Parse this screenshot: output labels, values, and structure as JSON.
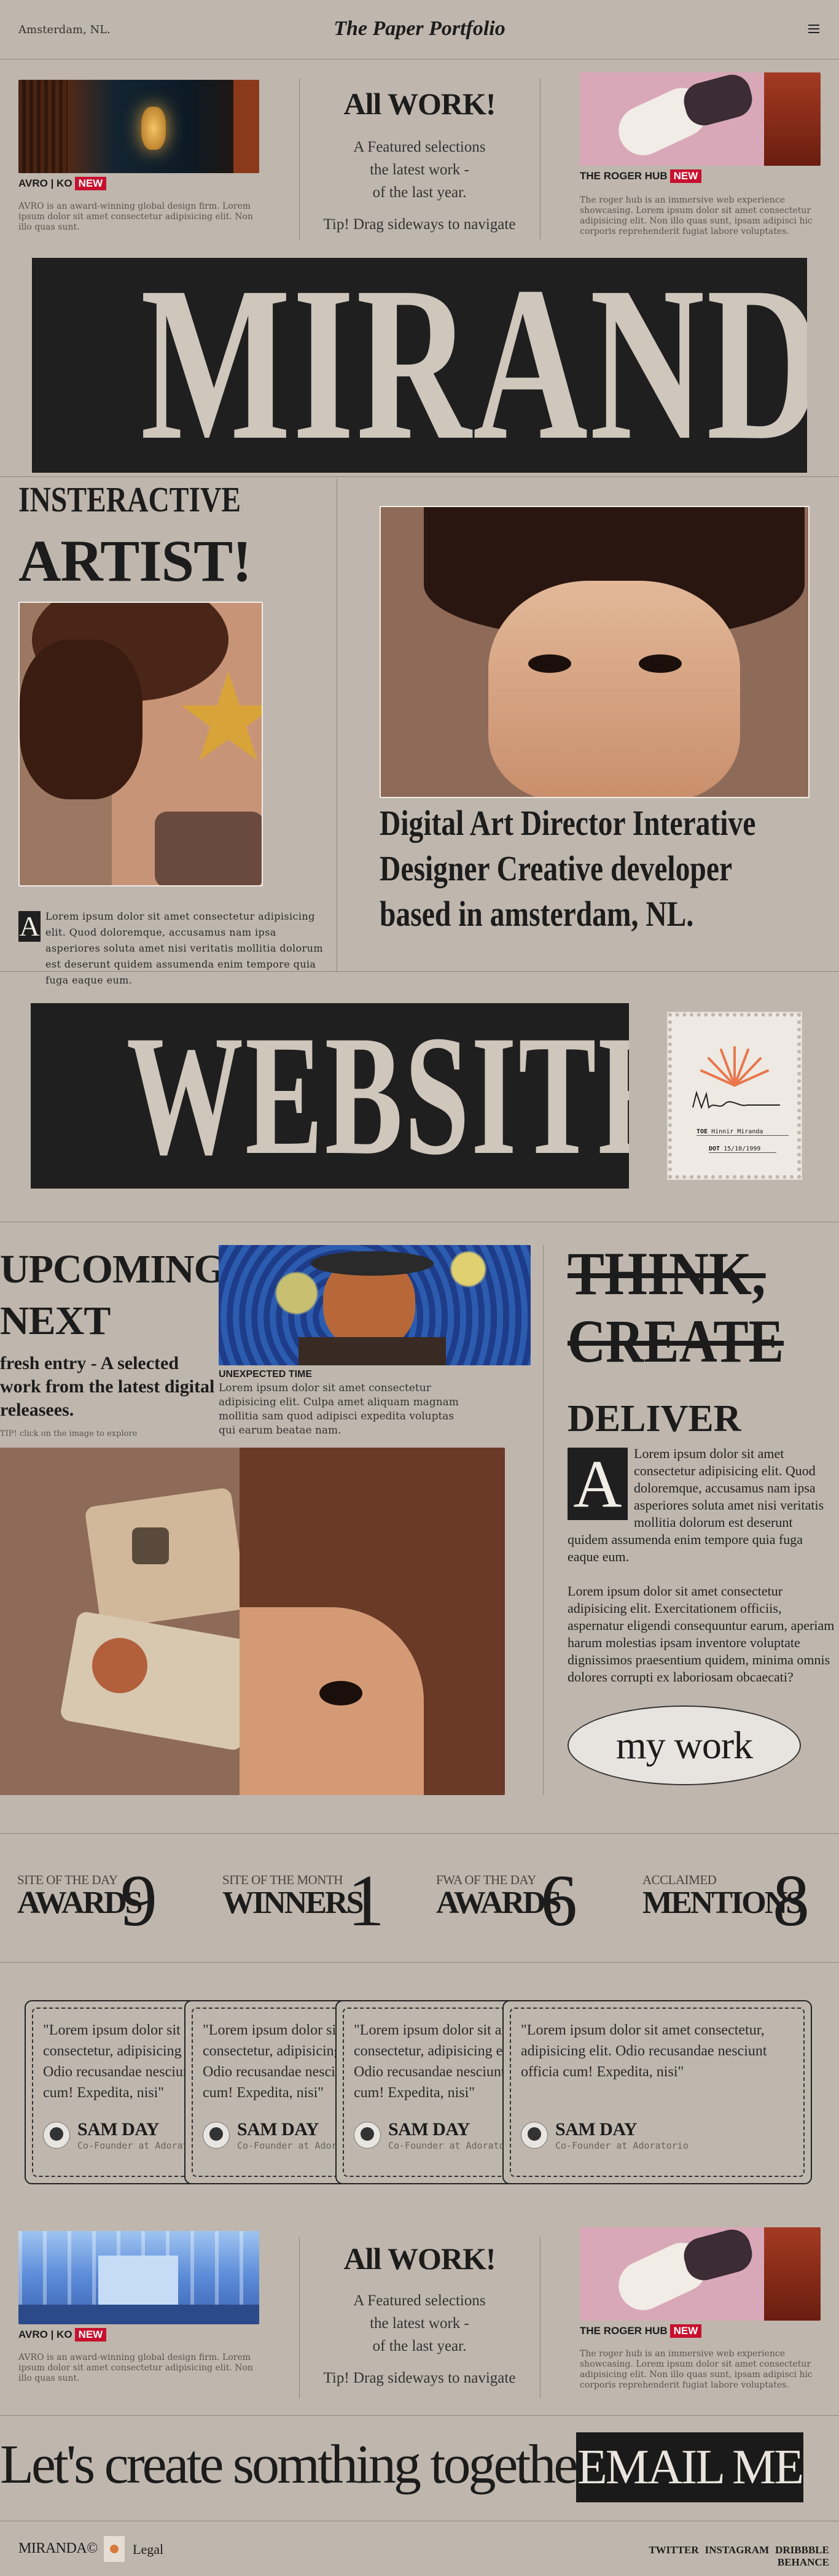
{
  "header": {
    "location": "Amsterdam, NL.",
    "brand": "The Paper Portfolio",
    "menu_icon": "hamburger-menu-icon"
  },
  "work_strip": {
    "left": {
      "title": "AVRO | KO",
      "badge": "NEW",
      "desc": "AVRO is an award-winning global design firm. Lorem ipsum dolor sit amet consectetur adipisicing elit. Non illo quas sunt."
    },
    "center": {
      "title": "All WORK!",
      "lines": [
        "A Featured selections",
        "the latest work -",
        "of the last year."
      ],
      "tip": "Tip! Drag sideways to navigate"
    },
    "right": {
      "title": "THE ROGER HUB",
      "badge": "NEW",
      "desc": "The roger hub is an immersive web experience showcasing. Lorem ipsum dolor sit amet consectetur adipisicing elit. Non illo quas sunt, ipsam adipisci hic corporis reprehenderit fugiat labore voluptates."
    }
  },
  "hero": {
    "name": "MIRANDA",
    "kicker1": "INSTERACTIVE",
    "kicker2": "ARTIST!",
    "dropcap": "A",
    "para": "Lorem ipsum dolor sit amet consectetur adipisicing elit. Quod doloremque, accusamus nam ipsa asperiores soluta amet nisi veritatis mollitia dolorum est deserunt quidem assumenda enim tempore quia fuga eaque eum.",
    "tagline": [
      "Digital Art Director Interative",
      "Designer Creative developer",
      "based in amsterdam, NL."
    ]
  },
  "website": {
    "word": "WEBSITE",
    "stamp": {
      "line1_label": "TOE",
      "line1_value": "Hinnir Miranda",
      "line2_label": "DOT",
      "line2_value": "15/10/1999"
    }
  },
  "upcoming": {
    "title1": "UPCOMING",
    "title2": "NEXT",
    "sub": "fresh entry - A selected work from the latest digital releasees.",
    "tip": "TIP! click on the image to explore",
    "caption_title": "UNEXPECTED TIME",
    "caption_text": "Lorem ipsum dolor sit amet consectetur adipisicing elit. Culpa amet aliquam magnam mollitia sam quod adipisci expedita voluptas qui earum beatae nam."
  },
  "think": {
    "line1": "THINK,",
    "line2": "CREATE",
    "line3": "DELIVER",
    "dropcap": "A",
    "para1": "Lorem ipsum dolor sit amet consectetur adipisicing elit. Quod doloremque, accusamus nam ipsa asperiores soluta amet nisi veritatis mollitia dolorum est deserunt quidem assumenda enim tempore quia fuga eaque eum.",
    "para2": "Lorem ipsum dolor sit amet consectetur adipisicing elit. Exercitationem officiis, aspernatur eligendi consequuntur earum, aperiam harum molestias ipsam inventore voluptate dignissimos praesentium quidem, minima omnis dolores corrupti ex laboriosam obcaecati?",
    "button": "my work"
  },
  "awards": [
    {
      "small": "SITE OF THE DAY",
      "big": "AWARDS",
      "num": "9"
    },
    {
      "small": "SITE OF THE MONTH",
      "big": "WINNERS",
      "num": "1"
    },
    {
      "small": "FWA OF THE DAY",
      "big": "AWARDS",
      "num": "6"
    },
    {
      "small": "ACCLAIMED",
      "big": "MENTIONS",
      "num": "8"
    }
  ],
  "testimonials": [
    {
      "quote": "\"Lorem ipsum dolor sit amet consectetur, adipisicing elit. Odio recusandae nesciunt officia cum! Expedita, nisi\"",
      "name": "SAM DAY",
      "role": "Co-Founder at Adoratorio"
    },
    {
      "quote": "\"Lorem ipsum dolor sit amet consectetur, adipisicing elit. Odio recusandae nesciunt officia cum! Expedita, nisi\"",
      "name": "SAM DAY",
      "role": "Co-Founder at Adoratorio"
    },
    {
      "quote": "\"Lorem ipsum dolor sit amet consectetur, adipisicing elit. Odio recusandae nesciunt officia cum! Expedita, nisi\"",
      "name": "SAM DAY",
      "role": "Co-Founder at Adoratorio"
    },
    {
      "quote": "\"Lorem ipsum dolor sit amet consectetur, adipisicing elit. Odio recusandae nesciunt officia cum! Expedita, nisi\"",
      "name": "SAM DAY",
      "role": "Co-Founder at Adoratorio"
    }
  ],
  "cta": {
    "text": "Let's create somthing together",
    "button": "EMAIL ME"
  },
  "footer": {
    "brand": "MIRANDA©",
    "legal": "Legal",
    "links": [
      "TWITTER",
      "INSTAGRAM",
      "DRIBBBLE",
      "BEHANCE"
    ]
  }
}
